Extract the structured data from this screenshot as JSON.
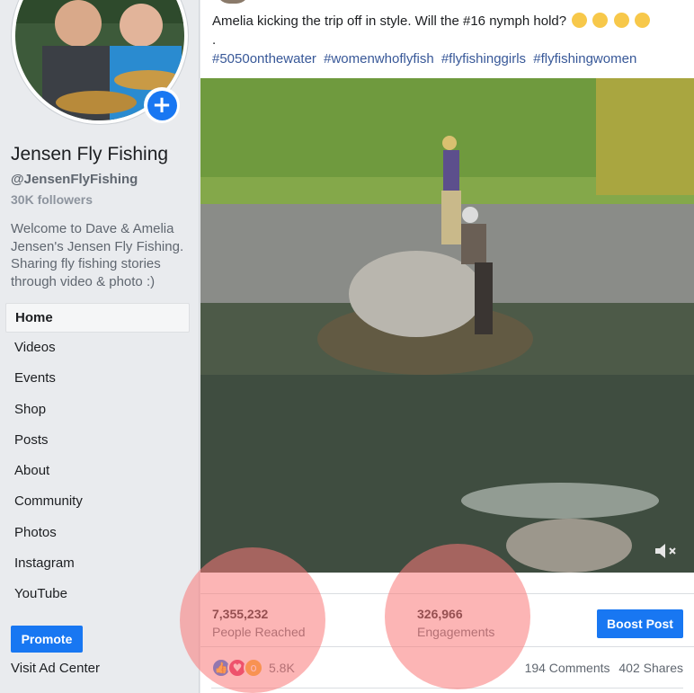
{
  "sidebar": {
    "page_name": "Jensen Fly Fishing",
    "handle": "@JensenFlyFishing",
    "followers": "30K followers",
    "about": "Welcome to Dave & Amelia Jensen's Jensen Fly Fishing. Sharing fly fishing stories through video & photo :)",
    "nav": [
      {
        "label": "Home",
        "active": true
      },
      {
        "label": "Videos"
      },
      {
        "label": "Events"
      },
      {
        "label": "Shop"
      },
      {
        "label": "Posts"
      },
      {
        "label": "About"
      },
      {
        "label": "Community"
      },
      {
        "label": "Photos"
      },
      {
        "label": "Instagram"
      },
      {
        "label": "YouTube"
      }
    ],
    "promote_label": "Promote",
    "visit_ad_center": "Visit Ad Center",
    "add_icon": "plus-icon"
  },
  "post": {
    "text": "Amelia kicking the trip off in style. Will the #16 nymph hold?",
    "emojis": [
      "thinking-face",
      "grimacing-face",
      "hugging-face",
      "zany-face"
    ],
    "separator": ".",
    "hashtags": [
      "#5050onthewater",
      "#womenwhoflyfish",
      "#flyfishinggirls",
      "#flyfishingwomen"
    ],
    "media_icon": "volume-muted-icon",
    "stats": {
      "reach_value": "7,355,232",
      "reach_label": "People Reached",
      "engagement_value": "326,966",
      "engagement_label": "Engagements",
      "boost_label": "Boost Post"
    },
    "reactions": {
      "icons": [
        "like-icon",
        "love-icon",
        "wow-icon"
      ],
      "count": "5.8K",
      "comments": "194 Comments",
      "shares": "402 Shares"
    }
  },
  "colors": {
    "accent": "#1877f2",
    "hashtag": "#385898",
    "highlight": "#fa7878"
  }
}
